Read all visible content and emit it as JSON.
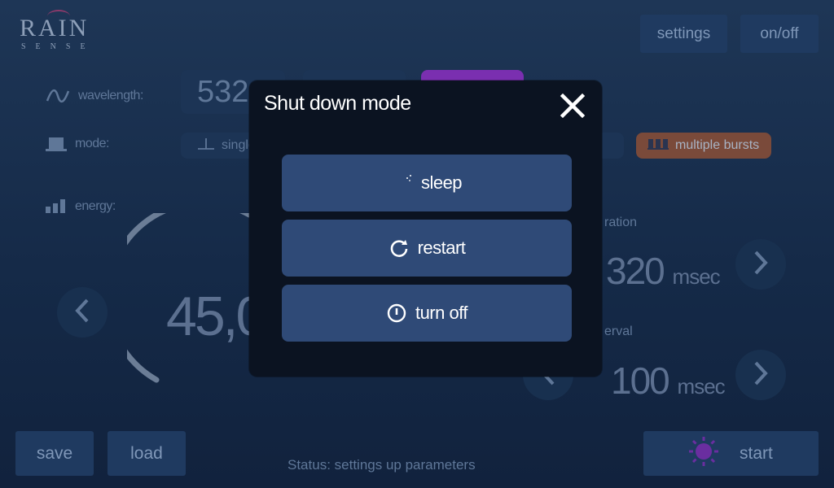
{
  "header": {
    "logo_main": "RAIN",
    "logo_sub": "SENSE",
    "settings_label": "settings",
    "onoff_label": "on/off"
  },
  "params": {
    "wavelength_label": "wavelength:",
    "wavelength_value": "532",
    "mode_label": "mode:",
    "mode_single_label": "single",
    "mode_multi_label": "multiple bursts",
    "energy_label": "energy:",
    "energy_value": "45,0",
    "duration_label": "ration",
    "duration_value": "320",
    "duration_unit": "msec",
    "interval_label": "erval",
    "interval_value": "100",
    "interval_unit": "msec"
  },
  "footer": {
    "save_label": "save",
    "load_label": "load",
    "start_label": "start",
    "status_text": "Status: settings up parameters"
  },
  "modal": {
    "title": "Shut down mode",
    "buttons": [
      {
        "label": "sleep",
        "icon": "moon-icon"
      },
      {
        "label": "restart",
        "icon": "restart-icon"
      },
      {
        "label": "turn off",
        "icon": "power-icon"
      }
    ]
  },
  "colors": {
    "accent_purple": "#7a2fb0",
    "modal_bg": "#0b1321",
    "modal_button": "#2f4a77"
  }
}
